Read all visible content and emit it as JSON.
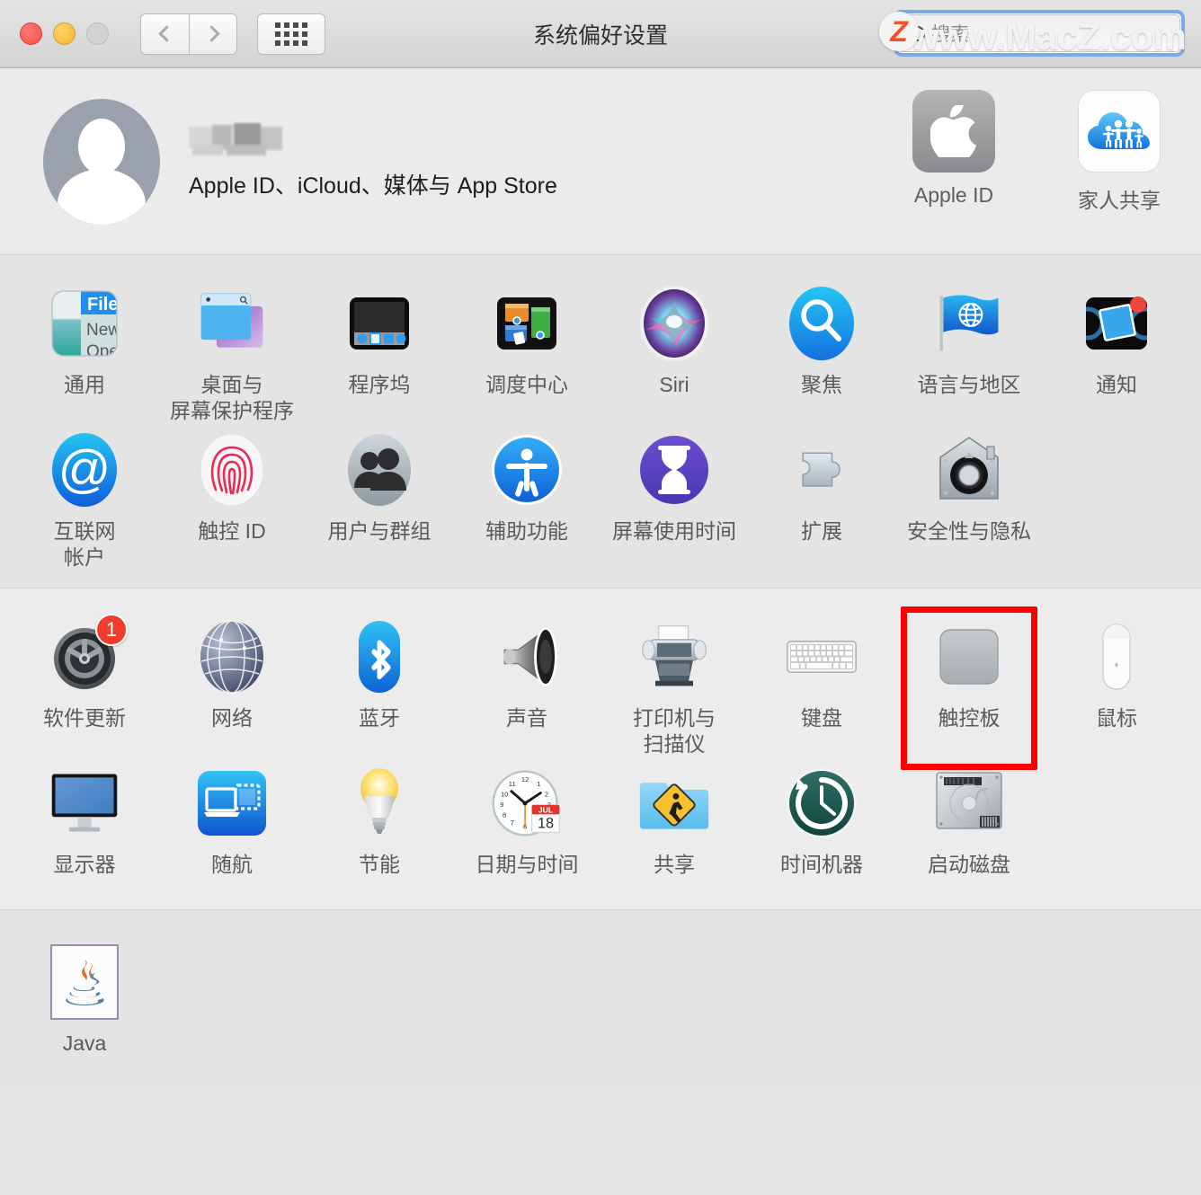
{
  "window": {
    "title": "系统偏好设置"
  },
  "toolbar": {
    "back_icon": "chevron-left-icon",
    "forward_icon": "chevron-right-icon",
    "grid_icon": "grid-view-icon",
    "traffic_close": "close-window-button",
    "traffic_minimize": "minimize-window-button",
    "traffic_zoom": "zoom-window-button"
  },
  "search": {
    "placeholder": "搜索",
    "value": "",
    "icon": "search-icon",
    "focus_color": "#7aabe8"
  },
  "watermark": {
    "text": "www.MacZ.com",
    "badge": "Z"
  },
  "account": {
    "name_redacted": "",
    "subtitle": "Apple ID、iCloud、媒体与 App Store",
    "avatar": "user-avatar-placeholder",
    "shortcuts": [
      {
        "label": "Apple ID",
        "icon": "apple-logo-icon"
      },
      {
        "label": "家人共享",
        "icon": "family-sharing-cloud-icon"
      }
    ]
  },
  "sections": [
    {
      "id": "personal",
      "items": [
        {
          "label": "通用",
          "icon": "general-icon"
        },
        {
          "label": "桌面与\n屏幕保护程序",
          "icon": "desktop-screensaver-icon"
        },
        {
          "label": "程序坞",
          "icon": "dock-icon"
        },
        {
          "label": "调度中心",
          "icon": "mission-control-icon"
        },
        {
          "label": "Siri",
          "icon": "siri-icon"
        },
        {
          "label": "聚焦",
          "icon": "spotlight-icon"
        },
        {
          "label": "语言与地区",
          "icon": "language-region-icon"
        },
        {
          "label": "通知",
          "icon": "notifications-icon"
        },
        {
          "label": "互联网\n帐户",
          "icon": "internet-accounts-icon"
        },
        {
          "label": "触控 ID",
          "icon": "touch-id-icon"
        },
        {
          "label": "用户与群组",
          "icon": "users-groups-icon"
        },
        {
          "label": "辅助功能",
          "icon": "accessibility-icon"
        },
        {
          "label": "屏幕使用时间",
          "icon": "screen-time-icon"
        },
        {
          "label": "扩展",
          "icon": "extensions-puzzle-icon"
        },
        {
          "label": "安全性与隐私",
          "icon": "security-privacy-icon"
        }
      ]
    },
    {
      "id": "hardware",
      "items": [
        {
          "label": "软件更新",
          "icon": "software-update-icon",
          "badge": "1"
        },
        {
          "label": "网络",
          "icon": "network-globe-icon"
        },
        {
          "label": "蓝牙",
          "icon": "bluetooth-icon"
        },
        {
          "label": "声音",
          "icon": "sound-speaker-icon"
        },
        {
          "label": "打印机与\n扫描仪",
          "icon": "printers-scanners-icon"
        },
        {
          "label": "键盘",
          "icon": "keyboard-icon"
        },
        {
          "label": "触控板",
          "icon": "trackpad-icon",
          "highlighted": true
        },
        {
          "label": "鼠标",
          "icon": "mouse-icon"
        },
        {
          "label": "显示器",
          "icon": "displays-icon"
        },
        {
          "label": "随航",
          "icon": "sidecar-icon"
        },
        {
          "label": "节能",
          "icon": "energy-saver-icon"
        },
        {
          "label": "日期与时间",
          "icon": "date-time-icon"
        },
        {
          "label": "共享",
          "icon": "sharing-folder-icon"
        },
        {
          "label": "时间机器",
          "icon": "time-machine-icon"
        },
        {
          "label": "启动磁盘",
          "icon": "startup-disk-icon"
        }
      ]
    },
    {
      "id": "other",
      "items": [
        {
          "label": "Java",
          "icon": "java-icon"
        }
      ]
    }
  ],
  "date_time_icon": {
    "month": "JUL",
    "day": "18"
  },
  "colors": {
    "window_bg": "#e6e6e6",
    "section_a": "#e4e4e4",
    "section_b": "#ececec",
    "label": "#5a5a5a",
    "highlight": "#ff0000",
    "badge": "#f33b2e"
  }
}
